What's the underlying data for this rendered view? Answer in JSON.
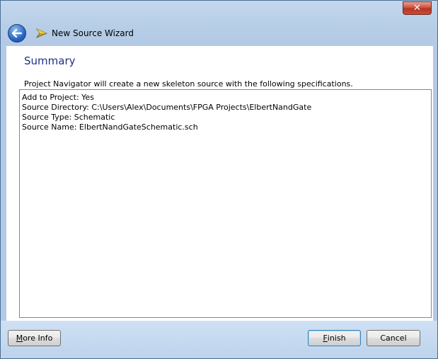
{
  "window": {
    "title": "New Source Wizard",
    "close_icon": "close-icon"
  },
  "header": {
    "back_icon": "back-arrow-icon",
    "wizard_icon": "wizard-icon"
  },
  "page": {
    "title": "Summary",
    "description": "Project Navigator will create a new skeleton source with the following specifications."
  },
  "summary": {
    "lines": [
      "Add to Project: Yes",
      "Source Directory: C:\\Users\\Alex\\Documents\\FPGA Projects\\ElbertNandGate",
      "Source Type: Schematic",
      "Source Name: ElbertNandGateSchematic.sch"
    ]
  },
  "buttons": {
    "more_info_mnemonic": "M",
    "more_info_rest": "ore Info",
    "finish_mnemonic": "F",
    "finish_rest": "inish",
    "cancel_label": "Cancel"
  },
  "colors": {
    "title_color": "#1e3287",
    "frame_blue": "#b6cde7"
  }
}
